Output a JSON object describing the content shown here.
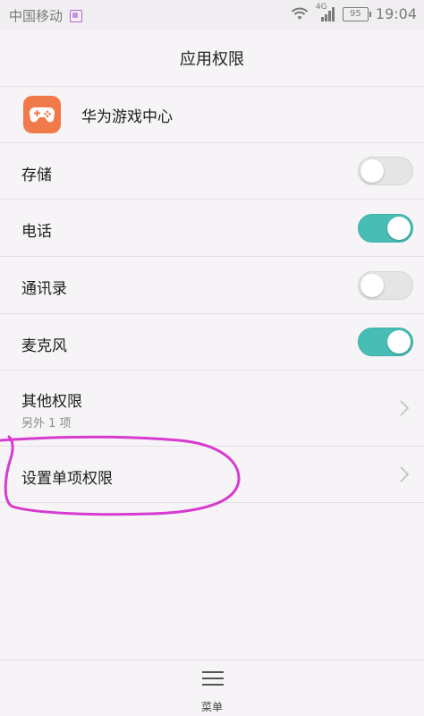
{
  "status_bar": {
    "carrier": "中国移动",
    "network": "4G",
    "battery": "95",
    "time": "19:04"
  },
  "header": {
    "title": "应用权限"
  },
  "app": {
    "name": "华为游戏中心",
    "icon_name": "gamepad-icon",
    "icon_color": "#f07a4a"
  },
  "permissions": [
    {
      "label": "存储",
      "enabled": false
    },
    {
      "label": "电话",
      "enabled": true
    },
    {
      "label": "通讯录",
      "enabled": false
    },
    {
      "label": "麦克风",
      "enabled": true
    }
  ],
  "other_permissions": {
    "label": "其他权限",
    "sub": "另外 1 项"
  },
  "single_permission": {
    "label": "设置单项权限"
  },
  "bottom_menu": {
    "label": "菜单"
  },
  "colors": {
    "toggle_on": "#47bdb6",
    "toggle_off": "#e6e5e6",
    "annotation": "#d63ad0"
  }
}
